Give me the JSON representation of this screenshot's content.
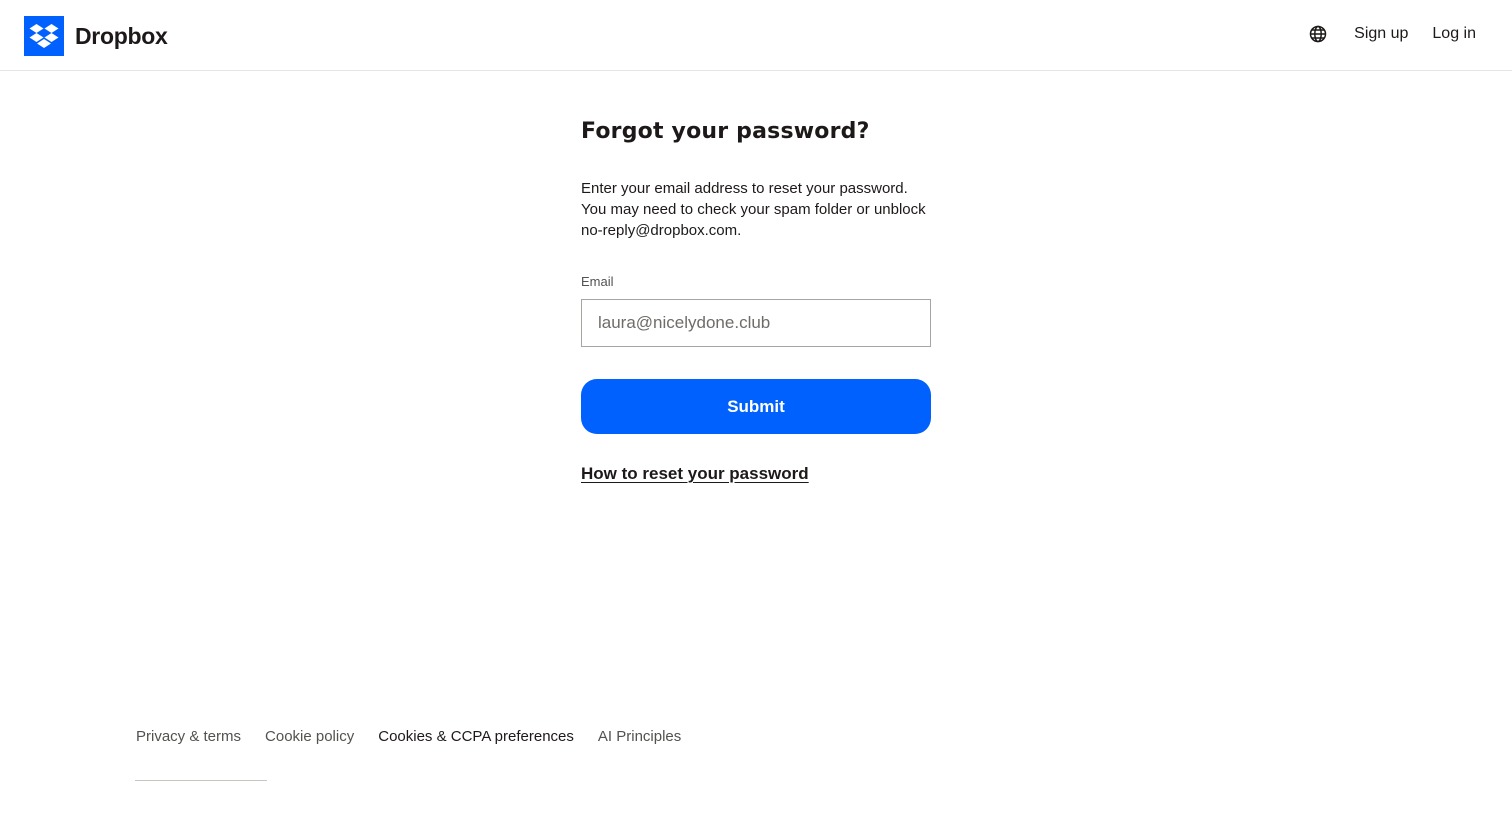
{
  "header": {
    "brand": "Dropbox",
    "nav": {
      "signup": "Sign up",
      "login": "Log in"
    }
  },
  "main": {
    "title": "Forgot your password?",
    "description_lines": [
      "Enter your email address to reset your password.",
      "You may need to check your spam folder or unblock",
      "no-reply@dropbox.com."
    ],
    "email_label": "Email",
    "email_value": "laura@nicelydone.club",
    "submit_label": "Submit",
    "help_link": "How to reset your password"
  },
  "footer": {
    "links": [
      "Privacy & terms",
      "Cookie policy",
      "Cookies & CCPA preferences",
      "AI Principles"
    ]
  },
  "colors": {
    "brand_blue": "#0061fe",
    "text": "#1e1919",
    "muted": "#52524f"
  }
}
